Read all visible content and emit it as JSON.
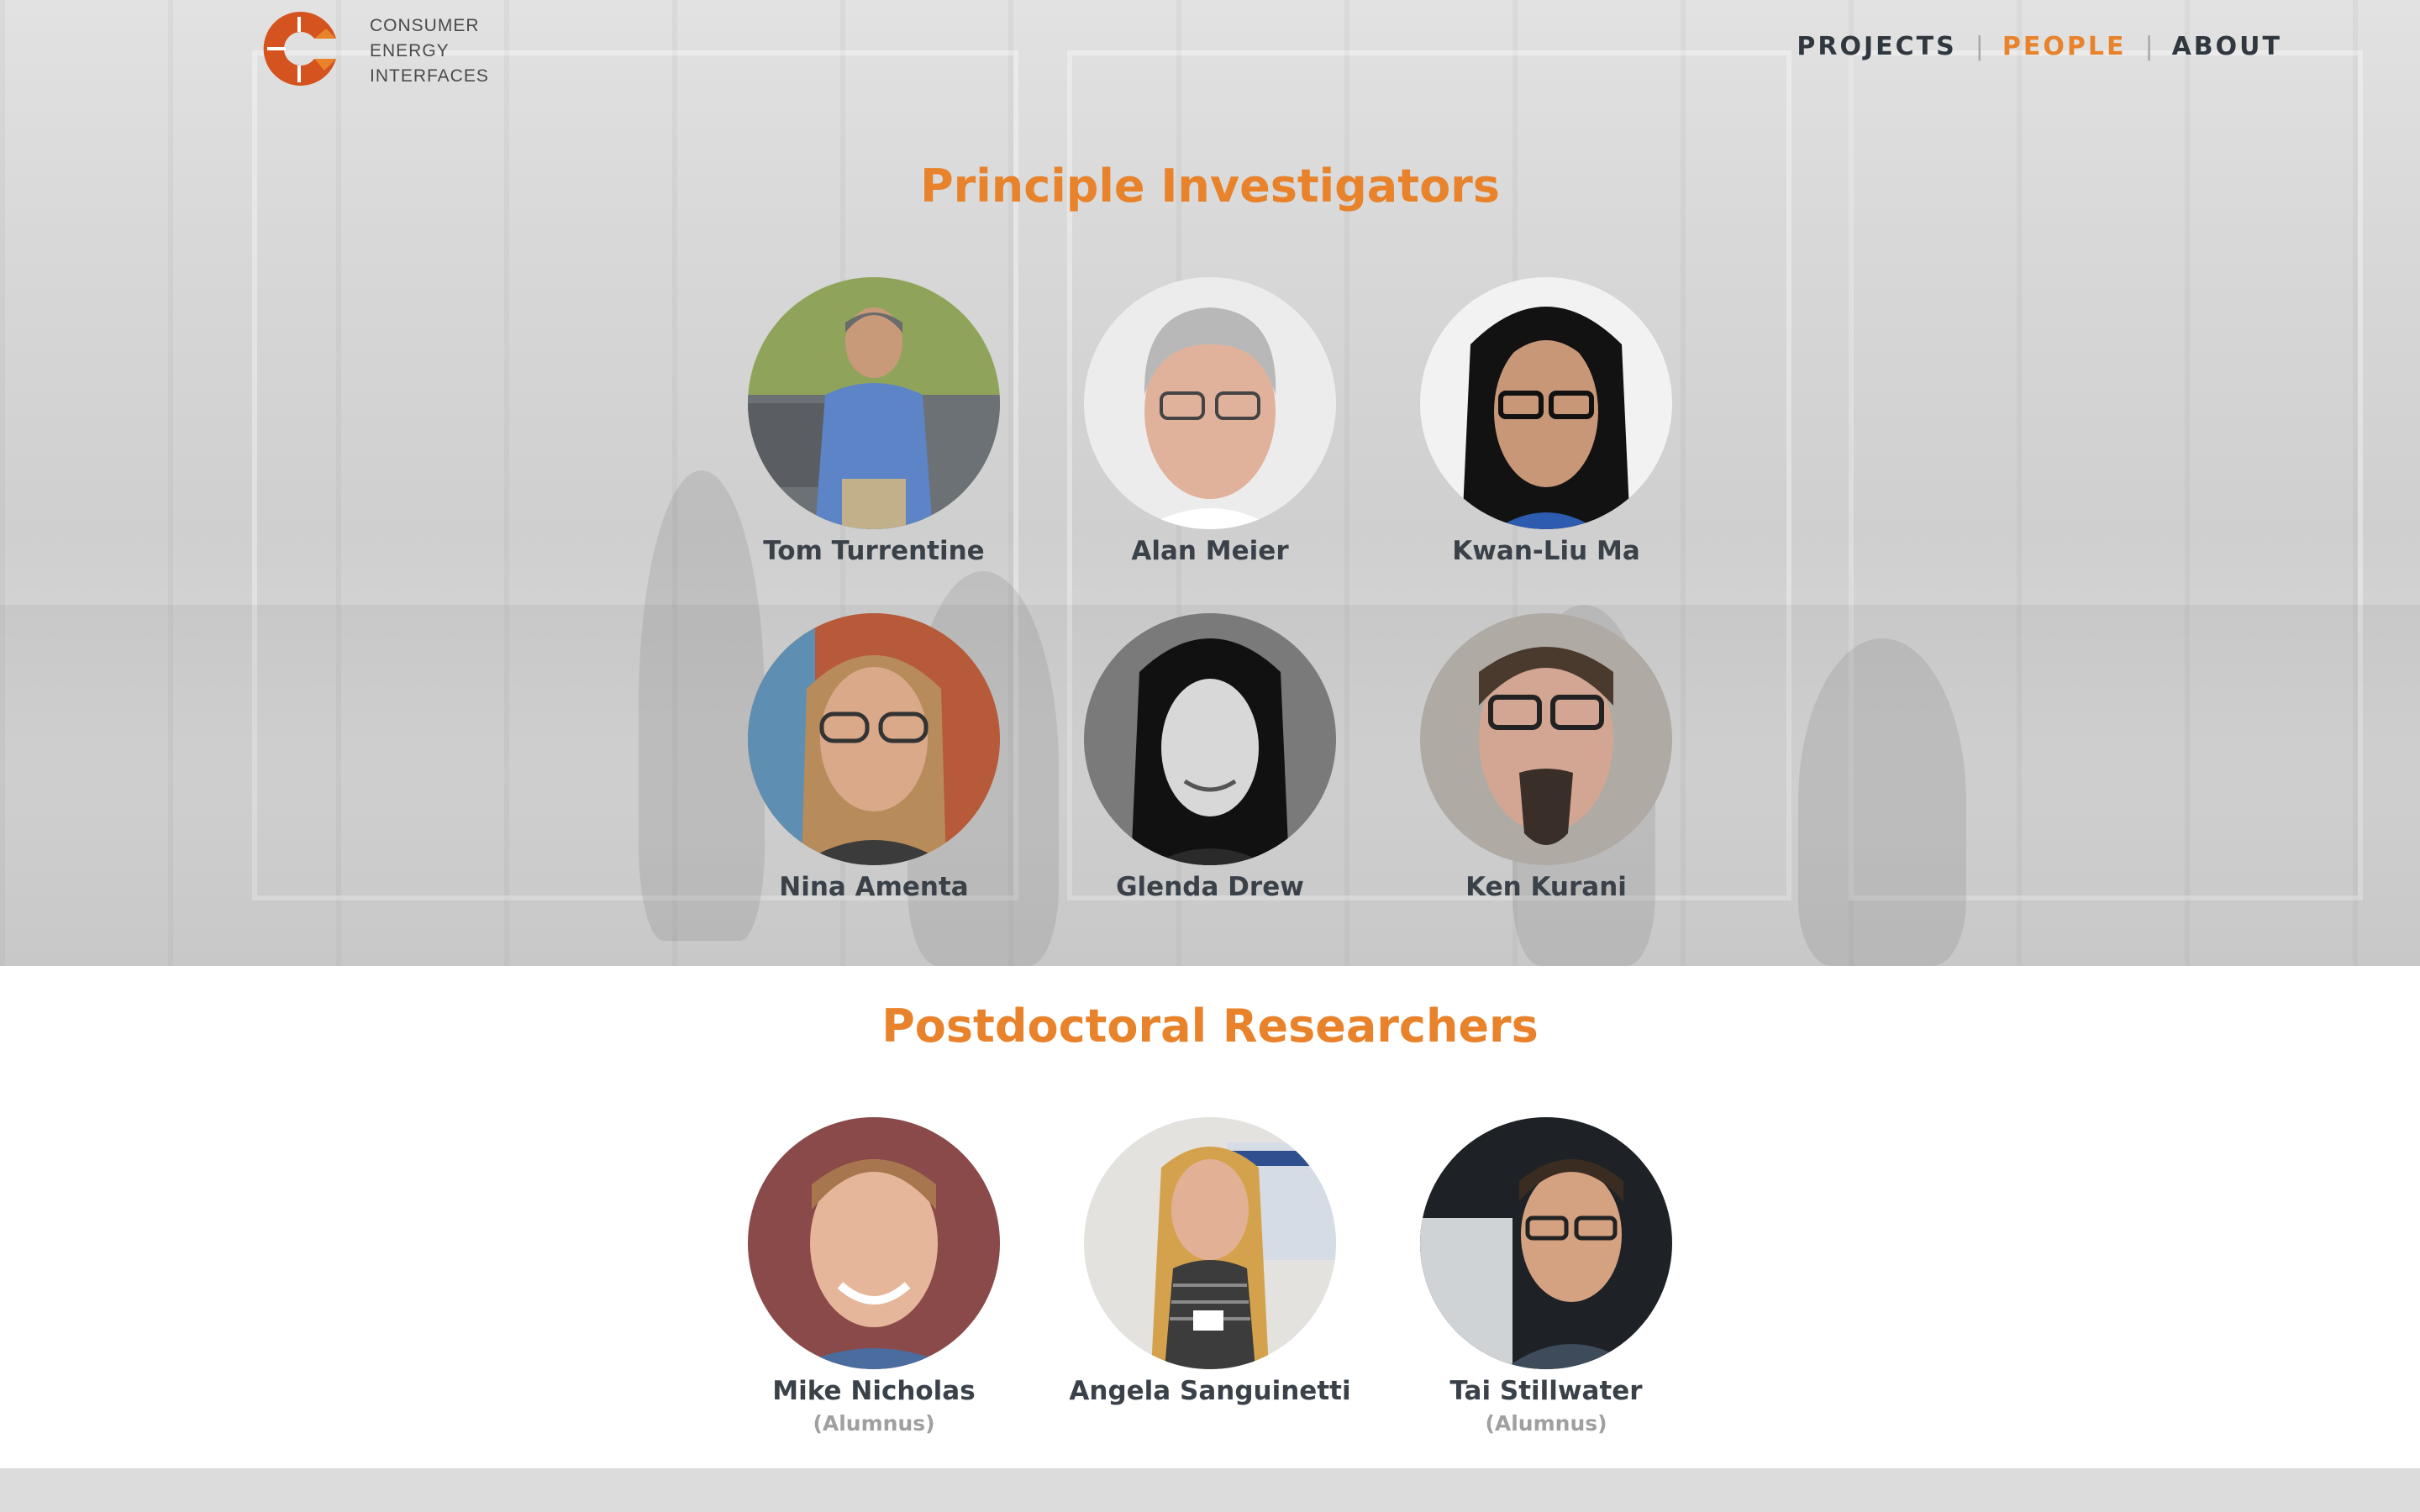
{
  "brand": {
    "logo_lines": [
      "CONSUMER",
      "ENERGY",
      "INTERFACES"
    ],
    "accent": "#e8822b",
    "logo_color": "#d4531f"
  },
  "nav": {
    "items": [
      {
        "label": "PROJECTS",
        "active": false
      },
      {
        "label": "PEOPLE",
        "active": true
      },
      {
        "label": "ABOUT",
        "active": false
      }
    ],
    "separator": "|"
  },
  "sections": {
    "pi": {
      "title": "Principle Investigators",
      "people": [
        {
          "name": "Tom Turrentine"
        },
        {
          "name": "Alan Meier"
        },
        {
          "name": "Kwan-Liu Ma"
        },
        {
          "name": "Nina Amenta"
        },
        {
          "name": "Glenda Drew"
        },
        {
          "name": "Ken Kurani"
        }
      ]
    },
    "postdoc": {
      "title": "Postdoctoral Researchers",
      "people": [
        {
          "name": "Mike Nicholas",
          "note": "(Alumnus)"
        },
        {
          "name": "Angela Sanguinetti",
          "note": ""
        },
        {
          "name": "Tai Stillwater",
          "note": "(Alumnus)"
        }
      ]
    }
  }
}
